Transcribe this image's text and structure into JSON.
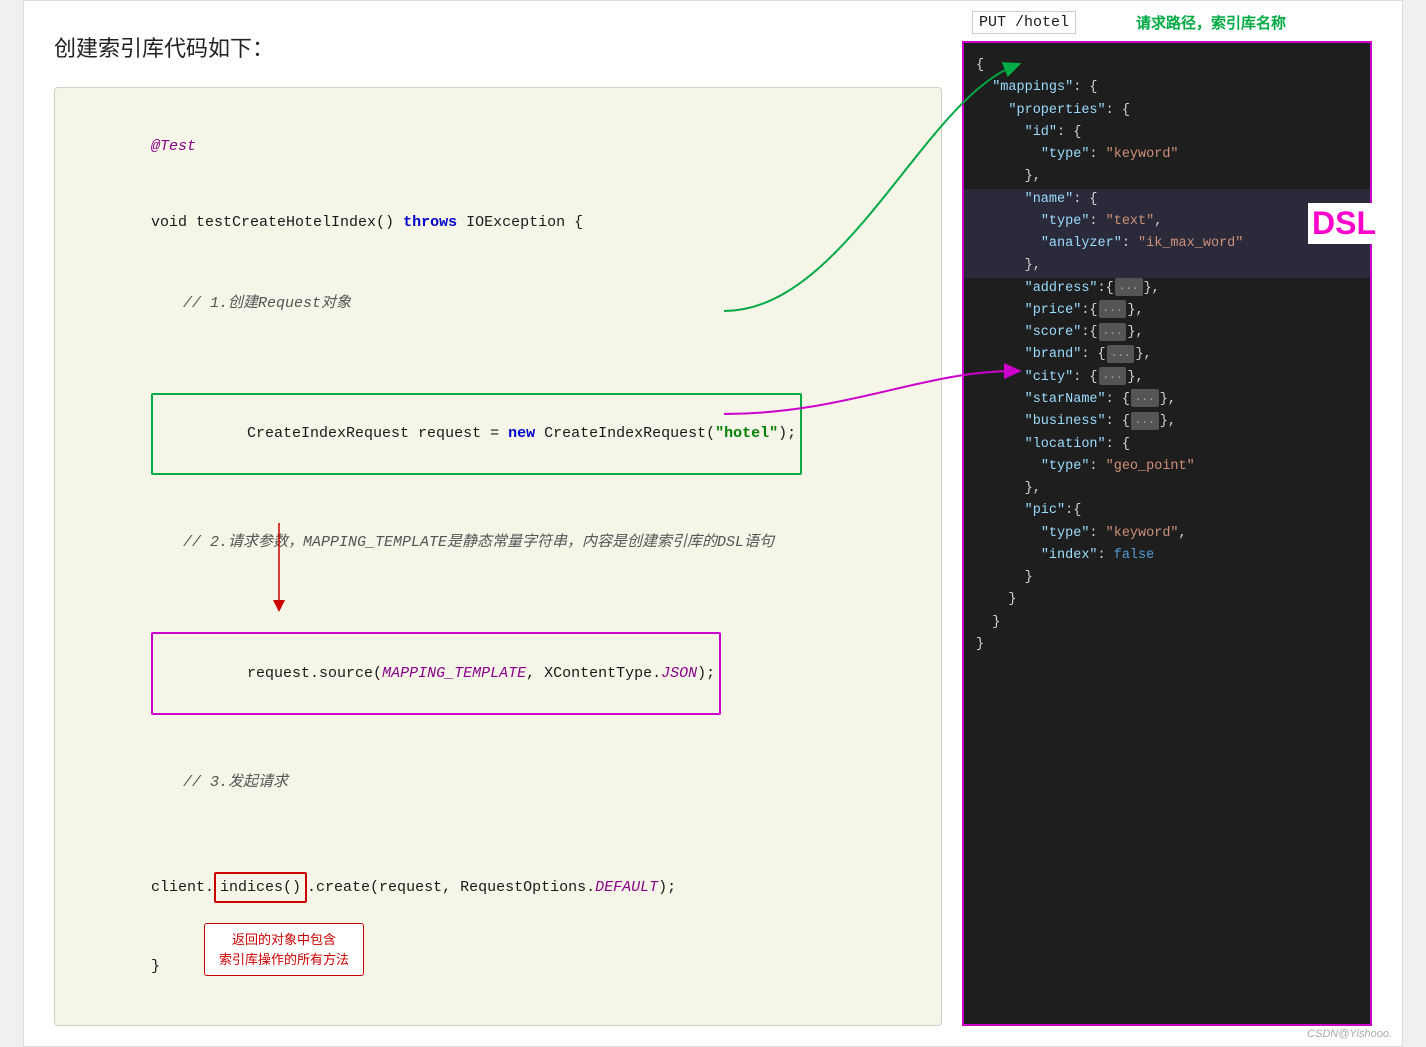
{
  "page": {
    "heading": "创建索引库代码如下：",
    "watermark": "CSDN@Yishooo."
  },
  "left": {
    "annotation_test": "@Test",
    "method_sig_1": "void testCreateHotelIndex() ",
    "method_sig_throws": "throws",
    "method_sig_2": " IOException {",
    "comment1": "// 1.创建Request对象",
    "line_create_1": "CreateIndexRequest request = ",
    "line_create_new": "new",
    "line_create_2": " CreateIndexRequest(",
    "line_create_str": "\"hotel\"",
    "line_create_end": ");",
    "comment2": "// 2.请求参数，MAPPING_TEMPLATE是静态常量字符串，内容是创建索引库的DSL语句",
    "line_source_1": "request.source(",
    "line_source_var": "MAPPING_TEMPLATE",
    "line_source_2": ", XContentType.",
    "line_source_json": "JSON",
    "line_source_end": ");",
    "comment3": "// 3.发起请求",
    "line_client_1": "client.",
    "line_client_indices": "indices()",
    "line_client_2": ".create(request, RequestOptions.",
    "line_client_default": "DEFAULT",
    "line_client_end": ");",
    "brace_close": "}",
    "callout_red": "返回的对象中包含\n索引库操作的所有方法"
  },
  "right": {
    "put_label": "PUT /hotel",
    "req_label": "请求路径，索引库名称",
    "dsl_label": "DSL",
    "lines": [
      "{",
      "  \"mappings\": {",
      "    \"properties\": {",
      "      \"id\": {",
      "        \"type\": \"keyword\"",
      "      },",
      "      \"name\": {",
      "        \"type\": \"text\",",
      "        \"analyzer\": \"ik_max_word\"",
      "      },",
      "      \"address\":{...},",
      "      \"price\":{...},",
      "      \"score\":{...},",
      "      \"brand\": {...},",
      "      \"city\": {...},",
      "      \"starName\": {...},",
      "      \"business\": {...},",
      "      \"location\": {",
      "        \"type\": \"geo_point\"",
      "      },",
      "      \"pic\":{",
      "        \"type\": \"keyword\",",
      "        \"index\": false",
      "      }",
      "    }",
      "  }",
      "}"
    ]
  }
}
